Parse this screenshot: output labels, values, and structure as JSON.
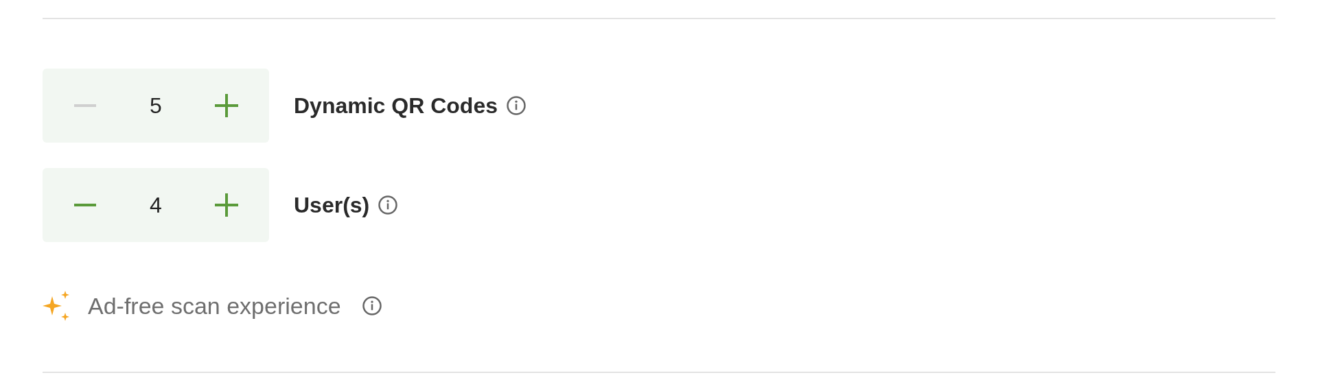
{
  "steppers": [
    {
      "value": "5",
      "label": "Dynamic QR Codes",
      "decrease_disabled": true
    },
    {
      "value": "4",
      "label": "User(s)",
      "decrease_disabled": false
    }
  ],
  "feature": {
    "label": "Ad-free scan experience"
  }
}
